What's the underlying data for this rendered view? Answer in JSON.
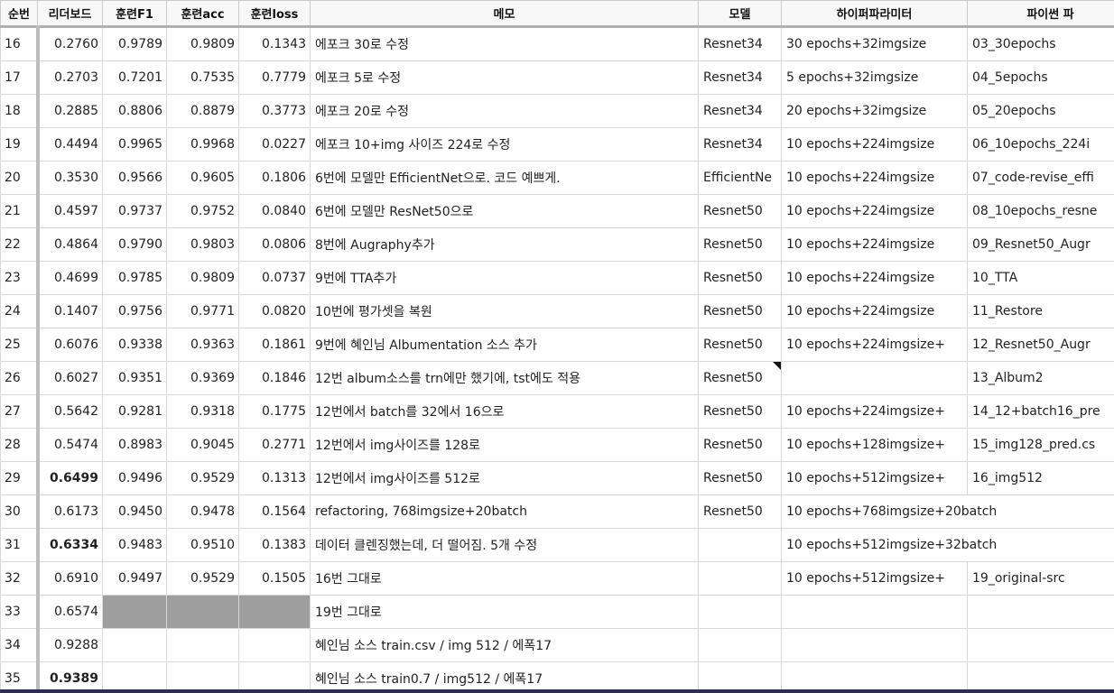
{
  "headers": [
    "순번",
    "리더보드",
    "훈련F1",
    "훈련acc",
    "훈련loss",
    "메모",
    "모델",
    "하이퍼파라미터",
    "파이썬 파"
  ],
  "rows": [
    {
      "n": "16",
      "lb": "0.2760",
      "f1": "0.9789",
      "acc": "0.9809",
      "loss": "0.1343",
      "memo": "에포크 30로 수정",
      "model": "Resnet34",
      "hp": "30 epochs+32imgsize",
      "py": "03_30epochs"
    },
    {
      "n": "17",
      "lb": "0.2703",
      "f1": "0.7201",
      "acc": "0.7535",
      "loss": "0.7779",
      "memo": "에포크 5로 수정",
      "model": "Resnet34",
      "hp": "5 epochs+32imgsize",
      "py": "04_5epochs"
    },
    {
      "n": "18",
      "lb": "0.2885",
      "f1": "0.8806",
      "acc": "0.8879",
      "loss": "0.3773",
      "memo": "에포크 20로 수정",
      "model": "Resnet34",
      "hp": "20 epochs+32imgsize",
      "py": "05_20epochs"
    },
    {
      "n": "19",
      "lb": "0.4494",
      "f1": "0.9965",
      "acc": "0.9968",
      "loss": "0.0227",
      "memo": "에포크 10+img 사이즈 224로 수정",
      "model": "Resnet34",
      "hp": "10 epochs+224imgsize",
      "py": "06_10epochs_224i"
    },
    {
      "n": "20",
      "lb": "0.3530",
      "f1": "0.9566",
      "acc": "0.9605",
      "loss": "0.1806",
      "memo": "6번에 모델만 EfficientNet으로. 코드 예쁘게.",
      "model": "EfficientNe",
      "hp": "10 epochs+224imgsize",
      "py": "07_code-revise_effi"
    },
    {
      "n": "21",
      "lb": "0.4597",
      "f1": "0.9737",
      "acc": "0.9752",
      "loss": "0.0840",
      "memo": "6번에 모델만 ResNet50으로",
      "model": "Resnet50",
      "hp": "10 epochs+224imgsize",
      "py": "08_10epochs_resne"
    },
    {
      "n": "22",
      "lb": "0.4864",
      "f1": "0.9790",
      "acc": "0.9803",
      "loss": "0.0806",
      "memo": "8번에 Augraphy추가",
      "model": "Resnet50",
      "hp": "10 epochs+224imgsize",
      "py": "09_Resnet50_Augr"
    },
    {
      "n": "23",
      "lb": "0.4699",
      "f1": "0.9785",
      "acc": "0.9809",
      "loss": "0.0737",
      "memo": "9번에 TTA추가",
      "model": "Resnet50",
      "hp": "10 epochs+224imgsize",
      "py": "10_TTA"
    },
    {
      "n": "24",
      "lb": "0.1407",
      "f1": "0.9756",
      "acc": "0.9771",
      "loss": "0.0820",
      "memo": "10번에 평가셋을 복원",
      "model": "Resnet50",
      "hp": "10 epochs+224imgsize",
      "py": "11_Restore"
    },
    {
      "n": "25",
      "lb": "0.6076",
      "f1": "0.9338",
      "acc": "0.9363",
      "loss": "0.1861",
      "memo": "9번에 혜인님 Albumentation 소스 추가",
      "model": "Resnet50",
      "hp": "10 epochs+224imgsize+",
      "py": "12_Resnet50_Augr"
    },
    {
      "n": "26",
      "lb": "0.6027",
      "f1": "0.9351",
      "acc": "0.9369",
      "loss": "0.1846",
      "memo": "12번 album소스를 trn에만 했기에, tst에도 적용",
      "model": "Resnet50",
      "hp": "",
      "py": "13_Album2",
      "note": true
    },
    {
      "n": "27",
      "lb": "0.5642",
      "f1": "0.9281",
      "acc": "0.9318",
      "loss": "0.1775",
      "memo": "12번에서 batch를 32에서 16으로",
      "model": "Resnet50",
      "hp": "10 epochs+224imgsize+",
      "py": "14_12+batch16_pre"
    },
    {
      "n": "28",
      "lb": "0.5474",
      "f1": "0.8983",
      "acc": "0.9045",
      "loss": "0.2771",
      "memo": "12번에서 img사이즈를 128로",
      "model": "Resnet50",
      "hp": "10 epochs+128imgsize+",
      "py": "15_img128_pred.cs"
    },
    {
      "n": "29",
      "lb": "0.6499",
      "f1": "0.9496",
      "acc": "0.9529",
      "loss": "0.1313",
      "memo": "12번에서 img사이즈를 512로",
      "model": "Resnet50",
      "hp": "10 epochs+512imgsize+",
      "py": "16_img512",
      "bold": true
    },
    {
      "n": "30",
      "lb": "0.6173",
      "f1": "0.9450",
      "acc": "0.9478",
      "loss": "0.1564",
      "memo": "refactoring, 768imgsize+20batch",
      "model": "Resnet50",
      "hp": "10 epochs+768imgsize+20batch",
      "py": "",
      "span": true
    },
    {
      "n": "31",
      "lb": "0.6334",
      "f1": "0.9483",
      "acc": "0.9510",
      "loss": "0.1383",
      "memo": "데이터 클렌징했는데, 더 떨어짐. 5개 수정",
      "model": "",
      "hp": "10 epochs+512imgsize+32batch",
      "py": "",
      "span": true,
      "bold": true
    },
    {
      "n": "32",
      "lb": "0.6910",
      "f1": "0.9497",
      "acc": "0.9529",
      "loss": "0.1505",
      "memo": "16번 그대로",
      "model": "",
      "hp": "10 epochs+512imgsize+",
      "py": "19_original-src"
    },
    {
      "n": "33",
      "lb": "0.6574",
      "f1": "",
      "acc": "",
      "loss": "",
      "memo": "19번 그대로",
      "model": "",
      "hp": "",
      "py": "",
      "gray": true
    },
    {
      "n": "34",
      "lb": "0.9288",
      "f1": "",
      "acc": "",
      "loss": "",
      "memo": "혜인님 소스 train.csv / img 512 /  에폭17",
      "model": "",
      "hp": "",
      "py": ""
    },
    {
      "n": "35",
      "lb": "0.9389",
      "f1": "",
      "acc": "",
      "loss": "",
      "memo": "혜인님 소스 train0.7 / img512 / 에폭17",
      "model": "",
      "hp": "",
      "py": "",
      "bold": true
    }
  ],
  "colors": {
    "gray_cell": "#9e9e9e",
    "header_bg": "#f8f8f9",
    "grid": "#d8d8d8"
  }
}
